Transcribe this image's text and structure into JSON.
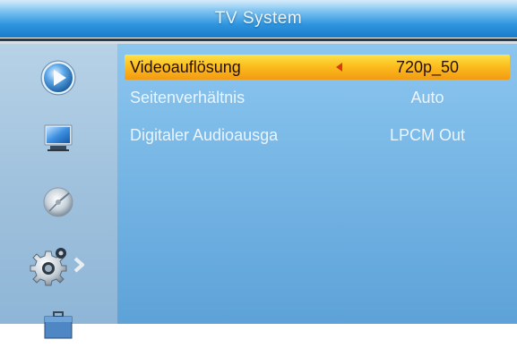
{
  "window": {
    "title": "TV System"
  },
  "sidebar": {
    "items": [
      {
        "icon": "play-icon"
      },
      {
        "icon": "tv-monitor-icon"
      },
      {
        "icon": "satellite-dish-icon"
      },
      {
        "icon": "gear-settings-icon",
        "active": true
      },
      {
        "icon": "toolbox-icon"
      }
    ]
  },
  "settings": [
    {
      "label": "Videoauflösung",
      "value": "720p_50",
      "selected": true
    },
    {
      "label": "Seitenverhältnis",
      "value": "Auto"
    },
    {
      "label": "Digitaler Audioausga",
      "value": "LPCM Out"
    }
  ],
  "colors": {
    "title_bar": "#2f95df",
    "content_bg": "#79b8e6",
    "sidebar_bg": "#9ec0dc",
    "highlight": "#fbbf1e",
    "arrow": "#d63c10"
  }
}
